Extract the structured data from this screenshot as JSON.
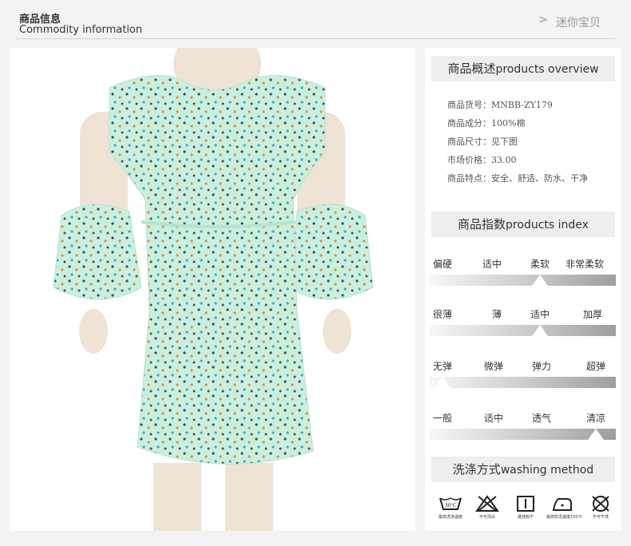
{
  "header": {
    "title": "商品信息",
    "subtitle": "Commodity information",
    "link": "迷你宝贝",
    "chevron": ">"
  },
  "overview": {
    "title_cn": "商品概述",
    "title_en": "products overview",
    "rows": [
      "商品货号：MNBB-ZY179",
      "商品成分：100%棉",
      "商品尺寸：见下图",
      "市场价格：33.00",
      "商品特点：安全、舒适、防水、干净"
    ]
  },
  "index": {
    "title_cn": "商品指数",
    "title_en": "products index",
    "scales": [
      {
        "labels": [
          "偏硬",
          "适中",
          "柔软",
          "非常柔软"
        ],
        "selected": 2
      },
      {
        "labels": [
          "很薄",
          "薄",
          "适中",
          "加厚"
        ],
        "selected": 2
      },
      {
        "labels": [
          "无弹",
          "微弹",
          "弹力",
          "超弹"
        ],
        "selected": 0
      },
      {
        "labels": [
          "一般",
          "适中",
          "透气",
          "清凉"
        ],
        "selected": 3
      }
    ]
  },
  "washing": {
    "title_cn": "洗涤方式",
    "title_en": "washing method",
    "items": [
      {
        "icon": "hand-wash-30-icon",
        "caption": "最高洗涤温度",
        "glyph": "30℃"
      },
      {
        "icon": "no-bleach-icon",
        "caption": "不可漂白"
      },
      {
        "icon": "tumble-dry-icon",
        "caption": "悬挂晾干"
      },
      {
        "icon": "iron-150-icon",
        "caption": "最高熨烫温度150℃"
      },
      {
        "icon": "no-dry-clean-icon",
        "caption": "不可干洗"
      }
    ]
  },
  "colors": {
    "fabric": "#c9f0df",
    "mannequin": "#efe3d6"
  }
}
